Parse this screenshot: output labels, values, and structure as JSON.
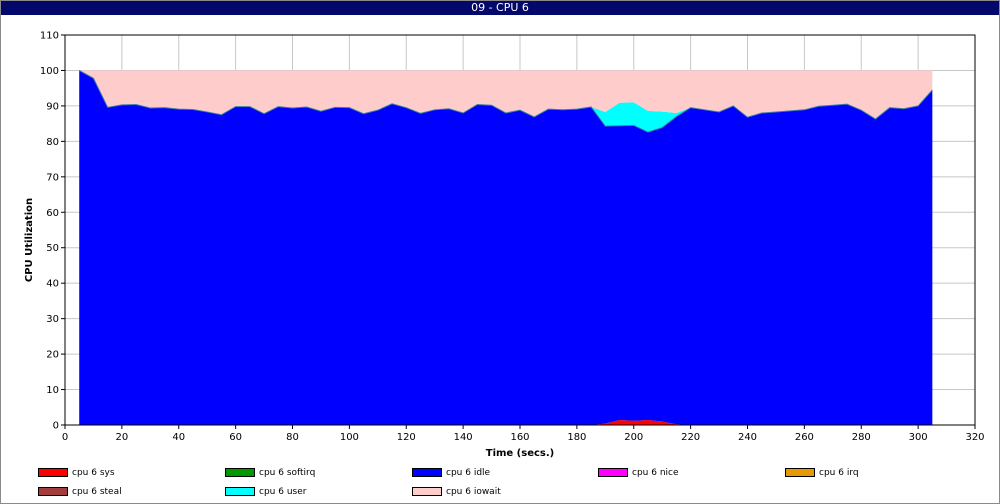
{
  "window": {
    "title": "09 - CPU 6"
  },
  "chart_data": {
    "type": "area",
    "stacked": true,
    "title": "",
    "xlabel": "Time (secs.)",
    "ylabel": "CPU Utilization",
    "xlim": [
      0,
      320
    ],
    "ylim": [
      0,
      110
    ],
    "xticks": [
      0,
      20,
      40,
      60,
      80,
      100,
      120,
      140,
      160,
      180,
      200,
      220,
      240,
      260,
      280,
      300,
      320
    ],
    "yticks": [
      0,
      10,
      20,
      30,
      40,
      50,
      60,
      70,
      80,
      90,
      100,
      110
    ],
    "grid": true,
    "legend_position": "bottom",
    "x": [
      5,
      10,
      15,
      20,
      25,
      30,
      35,
      40,
      45,
      50,
      55,
      60,
      65,
      70,
      75,
      80,
      85,
      90,
      95,
      100,
      105,
      110,
      115,
      120,
      125,
      130,
      135,
      140,
      145,
      150,
      155,
      160,
      165,
      170,
      175,
      180,
      185,
      190,
      195,
      200,
      205,
      210,
      215,
      220,
      225,
      230,
      235,
      240,
      245,
      250,
      255,
      260,
      265,
      270,
      275,
      280,
      285,
      290,
      295,
      300,
      305
    ],
    "series": [
      {
        "name": "cpu 6 sys",
        "color": "#ff0000",
        "values": [
          0,
          0,
          0,
          0,
          0,
          0,
          0,
          0,
          0,
          0,
          0,
          0,
          0,
          0,
          0,
          0,
          0,
          0,
          0,
          0,
          0,
          0,
          0,
          0,
          0,
          0,
          0,
          0,
          0,
          0,
          0,
          0,
          0,
          0,
          0,
          0,
          0,
          0.4,
          1.4,
          1.2,
          1.4,
          1.0,
          0.2,
          0,
          0,
          0,
          0,
          0,
          0,
          0,
          0,
          0,
          0,
          0,
          0,
          0,
          0,
          0,
          0,
          0,
          0
        ]
      },
      {
        "name": "cpu 6 softirq",
        "color": "#009900",
        "values": [
          0,
          0,
          0,
          0,
          0,
          0,
          0,
          0,
          0,
          0,
          0,
          0,
          0,
          0,
          0,
          0,
          0,
          0,
          0,
          0,
          0,
          0,
          0,
          0,
          0,
          0,
          0,
          0,
          0,
          0,
          0,
          0,
          0,
          0,
          0,
          0,
          0,
          0,
          0,
          0,
          0,
          0,
          0,
          0,
          0,
          0,
          0,
          0,
          0,
          0,
          0,
          0,
          0,
          0,
          0,
          0,
          0,
          0,
          0,
          0,
          0
        ]
      },
      {
        "name": "cpu 6 idle",
        "color": "#0000ff",
        "values": [
          100,
          97.8,
          89.6,
          90.3,
          90.4,
          89.4,
          89.5,
          89.1,
          89.0,
          88.3,
          87.5,
          89.8,
          89.8,
          87.8,
          89.8,
          89.4,
          89.7,
          88.5,
          89.6,
          89.5,
          87.8,
          88.8,
          90.6,
          89.5,
          87.9,
          88.9,
          89.2,
          88.0,
          90.4,
          90.2,
          88.0,
          88.8,
          86.9,
          89.1,
          88.9,
          89.1,
          89.7,
          83.9,
          83.0,
          83.3,
          81.2,
          82.9,
          86.8,
          89.5,
          88.9,
          88.3,
          90.0,
          86.8,
          88.0,
          88.3,
          88.6,
          88.9,
          89.9,
          90.2,
          90.5,
          88.8,
          86.3,
          89.5,
          89.2,
          90.0,
          94.5
        ]
      },
      {
        "name": "cpu 6 nice",
        "color": "#ff00ff",
        "values": [
          0,
          0,
          0,
          0,
          0,
          0,
          0,
          0,
          0,
          0,
          0,
          0,
          0,
          0,
          0,
          0,
          0,
          0,
          0,
          0,
          0,
          0,
          0,
          0,
          0,
          0,
          0,
          0,
          0,
          0,
          0,
          0,
          0,
          0,
          0,
          0,
          0,
          0,
          0,
          0,
          0,
          0,
          0,
          0,
          0,
          0,
          0,
          0,
          0,
          0,
          0,
          0,
          0,
          0,
          0,
          0,
          0,
          0,
          0,
          0,
          0
        ]
      },
      {
        "name": "cpu 6 irq",
        "color": "#e69900",
        "values": [
          0,
          0,
          0,
          0,
          0,
          0,
          0,
          0,
          0,
          0,
          0,
          0,
          0,
          0,
          0,
          0,
          0,
          0,
          0,
          0,
          0,
          0,
          0,
          0,
          0,
          0,
          0,
          0,
          0,
          0,
          0,
          0,
          0,
          0,
          0,
          0,
          0,
          0,
          0,
          0,
          0,
          0,
          0,
          0,
          0,
          0,
          0,
          0,
          0,
          0,
          0,
          0,
          0,
          0,
          0,
          0,
          0,
          0,
          0,
          0,
          0
        ]
      },
      {
        "name": "cpu 6 steal",
        "color": "#a33c3c",
        "values": [
          0,
          0,
          0,
          0,
          0,
          0,
          0,
          0,
          0,
          0,
          0,
          0,
          0,
          0,
          0,
          0,
          0,
          0,
          0,
          0,
          0,
          0,
          0,
          0,
          0,
          0,
          0,
          0,
          0,
          0,
          0,
          0,
          0,
          0,
          0,
          0,
          0,
          0,
          0,
          0,
          0,
          0,
          0,
          0,
          0,
          0,
          0,
          0,
          0,
          0,
          0,
          0,
          0,
          0,
          0,
          0,
          0,
          0,
          0,
          0,
          0
        ]
      },
      {
        "name": "cpu 6 user",
        "color": "#00ffff",
        "values": [
          0,
          0,
          0,
          0,
          0,
          0,
          0,
          0,
          0,
          0,
          0,
          0,
          0,
          0,
          0,
          0,
          0,
          0,
          0,
          0,
          0,
          0,
          0,
          0,
          0,
          0,
          0,
          0,
          0,
          0,
          0,
          0,
          0,
          0,
          0,
          0,
          0,
          4.0,
          6.5,
          6.5,
          6.0,
          4.5,
          1.0,
          0,
          0,
          0,
          0,
          0,
          0,
          0,
          0,
          0,
          0,
          0,
          0,
          0,
          0,
          0,
          0,
          0,
          0
        ]
      },
      {
        "name": "cpu 6 iowait",
        "color": "#ffcccc",
        "values": [
          0,
          2.2,
          10.4,
          9.7,
          9.6,
          10.6,
          10.5,
          10.9,
          11.0,
          11.7,
          12.5,
          10.2,
          10.2,
          12.2,
          10.2,
          10.6,
          10.3,
          11.5,
          10.4,
          10.5,
          12.2,
          11.2,
          9.4,
          10.5,
          12.1,
          11.1,
          10.8,
          12.0,
          9.6,
          9.8,
          12.0,
          11.2,
          13.1,
          10.9,
          11.1,
          10.9,
          10.3,
          11.7,
          9.1,
          9.0,
          11.4,
          11.6,
          12.0,
          10.5,
          11.1,
          11.7,
          10.0,
          13.2,
          12.0,
          11.7,
          11.4,
          11.1,
          10.1,
          9.8,
          9.5,
          11.2,
          13.7,
          10.5,
          10.8,
          10.0,
          5.5
        ]
      }
    ]
  }
}
